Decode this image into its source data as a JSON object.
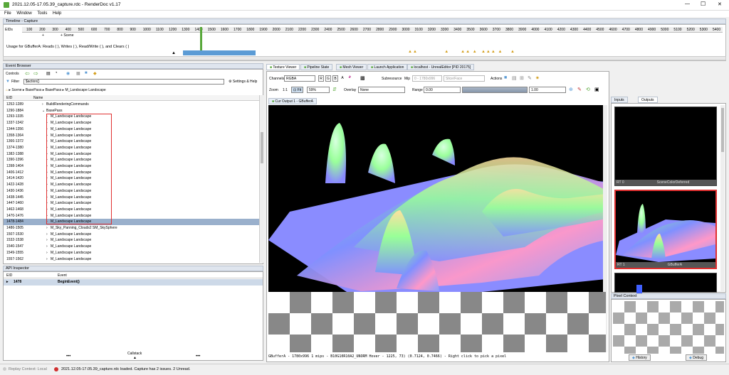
{
  "window": {
    "title": "2021.12.05-17.05.39_capture.rdc - RenderDoc v1.17",
    "min_glyph": "—",
    "max_glyph": "☐",
    "close_glyph": "✕"
  },
  "menu": [
    "File",
    "Window",
    "Tools",
    "Help"
  ],
  "timeline": {
    "title": "Timeline - Capture",
    "eid_label": "EIDs",
    "ticks": [
      "100",
      "200",
      "300",
      "400",
      "500",
      "600",
      "700",
      "800",
      "900",
      "1000",
      "1100",
      "1200",
      "1300",
      "1400",
      "1500",
      "1600",
      "1700",
      "1800",
      "1900",
      "2000",
      "2100",
      "2200",
      "2300",
      "2400",
      "2500",
      "2600",
      "2700",
      "2800",
      "2900",
      "3000",
      "3100",
      "3200",
      "3300",
      "3400",
      "3500",
      "3600",
      "3700",
      "3800",
      "3900",
      "4000",
      "4100",
      "4200",
      "4300",
      "4400",
      "4500",
      "4600",
      "4700",
      "4800",
      "4900",
      "5000",
      "5100",
      "5200",
      "5300",
      "5400"
    ],
    "row_label": "Scene",
    "usage": "Usage for GBufferA: Reads ( ), Writes ( ), Read/Write ( ), and Clears ( )"
  },
  "event_browser": {
    "title": "Event Browser",
    "controls_label": "Controls",
    "filter_label": "Filter",
    "filter_value": "$action()",
    "settings_label": "Settings & Help",
    "breadcrumb": [
      "Scene",
      "BasePass",
      "BasePass",
      "M_Landscape Landscape"
    ],
    "col_eid": "EID",
    "col_name": "Name",
    "rows": [
      {
        "eid": "1252-1289",
        "name": "BuildRenderingCommands",
        "indent": 1
      },
      {
        "eid": "1290-1884",
        "name": "BasePass",
        "indent": 1
      },
      {
        "eid": "1293-1335",
        "name": "M_Landscape Landscape",
        "indent": 2
      },
      {
        "eid": "1337-1342",
        "name": "M_Landscape Landscape",
        "indent": 2
      },
      {
        "eid": "1344-1356",
        "name": "M_Landscape Landscape",
        "indent": 2
      },
      {
        "eid": "1358-1364",
        "name": "M_Landscape Landscape",
        "indent": 2
      },
      {
        "eid": "1366-1372",
        "name": "M_Landscape Landscape",
        "indent": 2
      },
      {
        "eid": "1374-1380",
        "name": "M_Landscape Landscape",
        "indent": 2
      },
      {
        "eid": "1382-1388",
        "name": "M_Landscape Landscape",
        "indent": 2
      },
      {
        "eid": "1390-1396",
        "name": "M_Landscape Landscape",
        "indent": 2
      },
      {
        "eid": "1398-1404",
        "name": "M_Landscape Landscape",
        "indent": 2
      },
      {
        "eid": "1406-1412",
        "name": "M_Landscape Landscape",
        "indent": 2
      },
      {
        "eid": "1414-1420",
        "name": "M_Landscape Landscape",
        "indent": 2
      },
      {
        "eid": "1422-1428",
        "name": "M_Landscape Landscape",
        "indent": 2
      },
      {
        "eid": "1430-1436",
        "name": "M_Landscape Landscape",
        "indent": 2
      },
      {
        "eid": "1438-1445",
        "name": "M_Landscape Landscape",
        "indent": 2
      },
      {
        "eid": "1447-1460",
        "name": "M_Landscape Landscape",
        "indent": 2
      },
      {
        "eid": "1462-1468",
        "name": "M_Landscape Landscape",
        "indent": 2
      },
      {
        "eid": "1470-1476",
        "name": "M_Landscape Landscape",
        "indent": 2
      },
      {
        "eid": "1478-1484",
        "name": "M_Landscape Landscape",
        "indent": 2,
        "selected": true
      },
      {
        "eid": "1486-1505",
        "name": "M_Sky_Panning_Clouds2 SM_SkySphere",
        "indent": 2
      },
      {
        "eid": "1507-1530",
        "name": "M_Landscape Landscape",
        "indent": 2
      },
      {
        "eid": "1532-1538",
        "name": "M_Landscape Landscape",
        "indent": 2
      },
      {
        "eid": "1540-1547",
        "name": "M_Landscape Landscape",
        "indent": 2
      },
      {
        "eid": "1549-1555",
        "name": "M_Landscape Landscape",
        "indent": 2
      },
      {
        "eid": "1557-1562",
        "name": "M_Landscape Landscape",
        "indent": 2
      }
    ]
  },
  "api_inspector": {
    "title": "API Inspector",
    "col_eid": "EID",
    "col_event": "Event",
    "row_eid": "1478",
    "row_event": "BeginEvent()",
    "callstack_label": "Callstack",
    "dots": "•••"
  },
  "tabs": [
    {
      "label": "Texture Viewer",
      "active": true
    },
    {
      "label": "Pipeline State",
      "active": false
    },
    {
      "label": "Mesh Viewer",
      "active": false
    },
    {
      "label": "Launch Application",
      "active": false
    },
    {
      "label": "localhost - UnrealEditor [PID 20175]",
      "active": false
    }
  ],
  "texture_viewer": {
    "channels_label": "Channels",
    "channels_value": "RGBA",
    "rgba_buttons": [
      "R",
      "G",
      "B",
      "A"
    ],
    "subresource_label": "Subresource",
    "mip_label": "Mip",
    "mip_value": "0 - 1780x996",
    "slice_value": "Slice/Face",
    "actions_label": "Actions",
    "zoom_label": "Zoom",
    "zoom_11": "1:1",
    "fit_label": "Fit",
    "zoom_value": "59%",
    "overlay_label": "Overlay",
    "overlay_value": "None",
    "range_label": "Range",
    "range_min": "0.00",
    "range_max": "1.00",
    "output_tab": "Cur Output 1 - GBufferA",
    "status_text": "GBufferA - 1780x996 1 mips - B10G10R10A2_UNORM  Hover -  1225,  73) (0.7124, 0.7466) - Right click to pick a pixel"
  },
  "side_panel": {
    "tab_inputs": "Inputs",
    "tab_outputs": "Outputs",
    "thumb1_label_id": "RT 0",
    "thumb1_label": "SceneColorDeferred",
    "thumb2_label_id": "RT 1",
    "thumb2_label": "GBufferA",
    "pixel_context": "Pixel Context",
    "history_label": "History",
    "debug_label": "Debug"
  },
  "statusbar": {
    "replay": "Replay Context: Local",
    "message": "2021.12.05-17.05.39_capture.rdc loaded. Capture has 2 issues. 2 Unread."
  },
  "colors": {
    "panel_header": "#dfe5ee",
    "selection": "#9ab0cc",
    "highlight_box": "#e03030",
    "accent_green": "#58a83a"
  }
}
